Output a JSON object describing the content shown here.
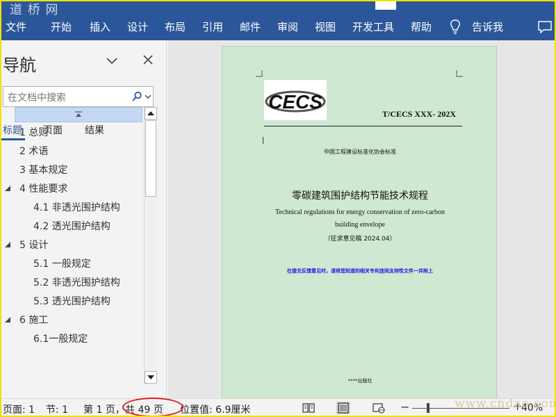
{
  "watermark_top": "道 桥 网",
  "ribbon": {
    "tabs": [
      "文件",
      "开始",
      "插入",
      "设计",
      "布局",
      "引用",
      "邮件",
      "审阅",
      "视图",
      "开发工具",
      "帮助"
    ],
    "tell_me": "告诉我"
  },
  "nav": {
    "title": "导航",
    "search_placeholder": "在文档中搜索",
    "tabs": [
      "标题",
      "页面",
      "结果"
    ],
    "headings": [
      {
        "label": "1 总则",
        "level": 1,
        "expandable": false
      },
      {
        "label": "2 术语",
        "level": 1,
        "expandable": false
      },
      {
        "label": "3 基本规定",
        "level": 1,
        "expandable": false
      },
      {
        "label": "4 性能要求",
        "level": 1,
        "expandable": true
      },
      {
        "label": "4.1 非透光围护结构",
        "level": 2,
        "expandable": false
      },
      {
        "label": "4.2 透光围护结构",
        "level": 2,
        "expandable": false
      },
      {
        "label": "5 设计",
        "level": 1,
        "expandable": true
      },
      {
        "label": "5.1 一般规定",
        "level": 2,
        "expandable": false
      },
      {
        "label": "5.2 非透光围护结构",
        "level": 2,
        "expandable": false
      },
      {
        "label": "5.3 透光围护结构",
        "level": 2,
        "expandable": false
      },
      {
        "label": "6 施工",
        "level": 1,
        "expandable": true
      },
      {
        "label": "6.1一般规定",
        "level": 2,
        "expandable": false
      }
    ]
  },
  "document": {
    "logo_text": "CECS",
    "standard_no": "T/CECS XXX- 202X",
    "org_line": "中国工程建设标准化协会标准",
    "title_cn": "零碳建筑围护结构节能技术规程",
    "title_en_1": "Technical regulations for energy conservation of zero-carbon",
    "title_en_2": "building envelope",
    "draft_note": "（征求意见稿 2024.04）",
    "blue_note": "在提交反馈意见时，请将您知道的相关专利连同支持性文件一并附上",
    "publisher": "****出版社"
  },
  "status": {
    "page": "页面: 1",
    "section": "节: 1",
    "page_of": "第 1 页，",
    "total": "共 49 页",
    "position": "位置值: 6.9厘米",
    "zoom": "40%"
  },
  "site_watermark": "www.cndao.com",
  "colors": {
    "ribbon": "#2b579a",
    "page_fill": "#cfe8d1",
    "highlight_ellipse": "#e0161a",
    "blue_note": "#1414e6"
  }
}
